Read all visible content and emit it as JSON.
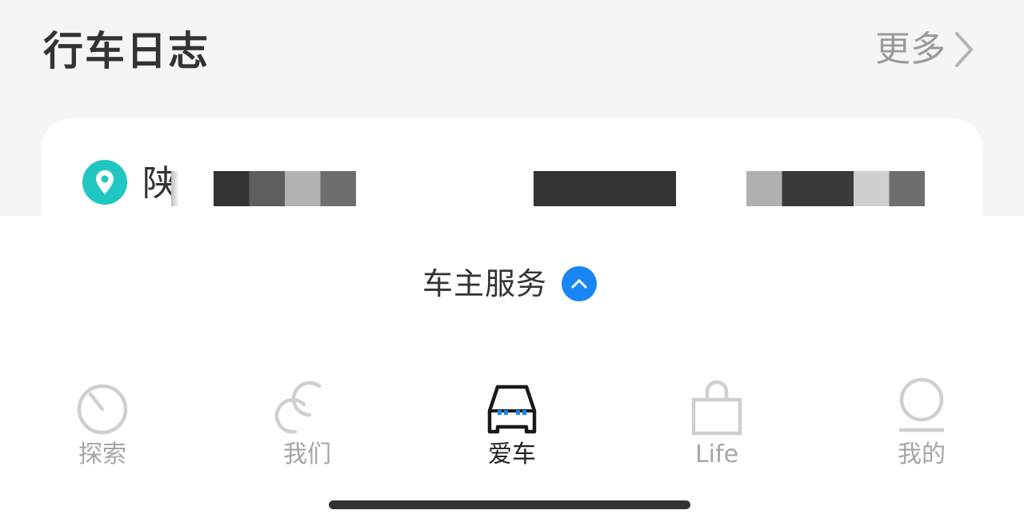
{
  "section": {
    "title": "行车日志",
    "more_label": "更多"
  },
  "log_card": {
    "province": "陕"
  },
  "service": {
    "label": "车主服务"
  },
  "tabs": [
    {
      "label": "探索",
      "icon": "compass-icon",
      "active": false
    },
    {
      "label": "我们",
      "icon": "link-icon",
      "active": false
    },
    {
      "label": "爱车",
      "icon": "car-icon",
      "active": true
    },
    {
      "label": "Life",
      "icon": "bag-icon",
      "active": false
    },
    {
      "label": "我的",
      "icon": "profile-icon",
      "active": false
    }
  ],
  "colors": {
    "accent_blue": "#1a86f5",
    "pin_teal": "#1fc6c2",
    "tab_inactive": "#a6a6a6",
    "tab_active": "#222222",
    "top_background": "#f4f5f7"
  }
}
